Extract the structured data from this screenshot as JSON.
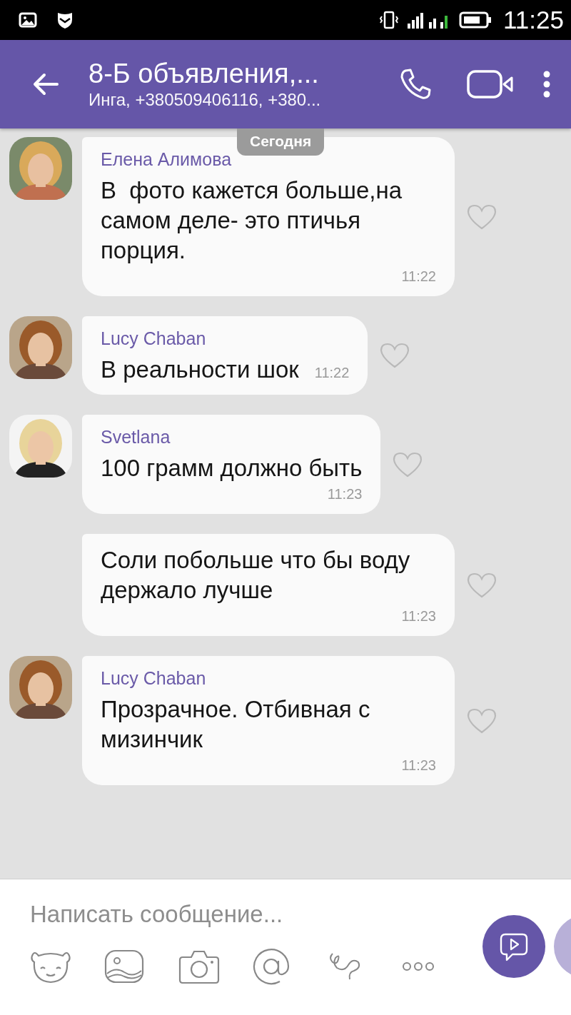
{
  "status_bar": {
    "time": "11:25"
  },
  "header": {
    "title": "8-Б объявления,...",
    "subtitle": "Инга, +380509406116, +380..."
  },
  "date_label": "Сегодня",
  "messages": [
    {
      "kind": "first",
      "sender": "Елена Алимова",
      "text": "В  фото кажется больше,на самом деле- это птичья порция.",
      "time": "11:22",
      "time_inline": false
    },
    {
      "kind": "first",
      "sender": "Lucy  Chaban",
      "text": "В реальности шок",
      "time": "11:22",
      "time_inline": true
    },
    {
      "kind": "first",
      "sender": "Svetlana",
      "text": "100 грамм должно быть",
      "time": "11:23",
      "time_inline": false
    },
    {
      "kind": "continuation",
      "text": "Соли побольше что бы воду держало лучше",
      "time": "11:23",
      "time_inline": false
    },
    {
      "kind": "first",
      "sender": "Lucy  Chaban",
      "text": "Прозрачное. Отбивная с мизинчик",
      "time": "11:23",
      "time_inline": false
    }
  ],
  "composer": {
    "placeholder": "Написать сообщение..."
  }
}
